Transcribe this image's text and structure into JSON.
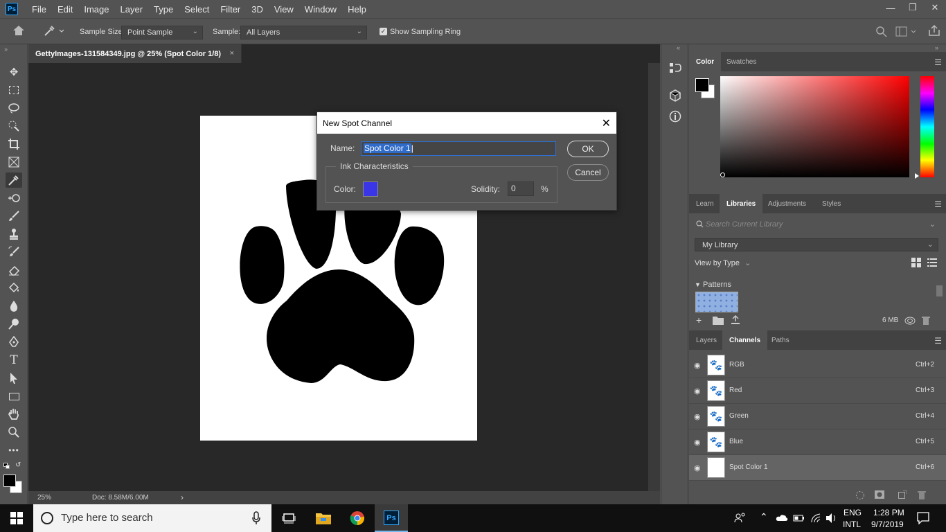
{
  "menubar": {
    "logo": "Ps",
    "items": [
      "File",
      "Edit",
      "Image",
      "Layer",
      "Type",
      "Select",
      "Filter",
      "3D",
      "View",
      "Window",
      "Help"
    ]
  },
  "options_bar": {
    "sample_size_label": "Sample Size:",
    "sample_size_value": "Point Sample",
    "sample_label": "Sample:",
    "sample_value": "All Layers",
    "show_sampling_ring_label": "Show Sampling Ring",
    "show_sampling_ring_checked": true
  },
  "document": {
    "tab_title": "GettyImages-131584349.jpg @ 25% (Spot Color 1/8)",
    "close_glyph": "×",
    "zoom": "25%",
    "doc_info": "Doc: 8.58M/6.00M"
  },
  "dialog": {
    "title": "New Spot Channel",
    "name_label": "Name:",
    "name_value": "Spot Color 1",
    "ink_group_label": "Ink Characteristics",
    "color_label": "Color:",
    "ink_color": "#3a35e6",
    "solidity_label": "Solidity:",
    "solidity_value": "0",
    "percent": "%",
    "ok_label": "OK",
    "cancel_label": "Cancel"
  },
  "color_panel": {
    "tabs": [
      "Color",
      "Swatches"
    ],
    "active_tab": "Color",
    "foreground": "#000000",
    "background": "#ffffff"
  },
  "libraries_panel": {
    "tabs": [
      "Learn",
      "Libraries",
      "Adjustments",
      "Styles"
    ],
    "active_tab": "Libraries",
    "search_placeholder": "Search Current Library",
    "library_name": "My Library",
    "view_by_label": "View by Type",
    "section_label": "Patterns",
    "storage": "6 MB"
  },
  "channels_panel": {
    "tabs": [
      "Layers",
      "Channels",
      "Paths"
    ],
    "active_tab": "Channels",
    "rows": [
      {
        "name": "RGB",
        "shortcut": "Ctrl+2"
      },
      {
        "name": "Red",
        "shortcut": "Ctrl+3"
      },
      {
        "name": "Green",
        "shortcut": "Ctrl+4"
      },
      {
        "name": "Blue",
        "shortcut": "Ctrl+5"
      },
      {
        "name": "Spot Color 1",
        "shortcut": "Ctrl+6"
      }
    ]
  },
  "taskbar": {
    "search_placeholder": "Type here to search",
    "language_top": "ENG",
    "language_bottom": "INTL",
    "time": "1:28 PM",
    "date": "9/7/2019"
  }
}
